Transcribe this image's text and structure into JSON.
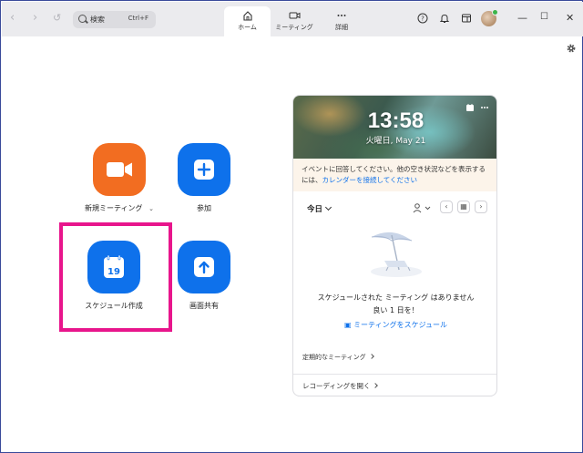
{
  "search": {
    "placeholder": "検索",
    "shortcut": "Ctrl+F"
  },
  "tabs": [
    {
      "label": "ホーム",
      "icon": "home-icon",
      "active": true
    },
    {
      "label": "ミーティング",
      "icon": "video-icon",
      "active": false
    },
    {
      "label": "詳細",
      "icon": "more-icon",
      "active": false
    }
  ],
  "window_controls": {
    "minimize": "—",
    "maximize": "☐",
    "close": "✕"
  },
  "actions": {
    "new_meeting": {
      "label": "新規ミーティング",
      "icon": "video-camera-icon",
      "color": "#f26d21"
    },
    "join": {
      "label": "参加",
      "icon": "plus-icon",
      "color": "#0e71eb"
    },
    "schedule": {
      "label": "スケジュール作成",
      "icon": "calendar-icon",
      "calendar_day": "19",
      "color": "#0e71eb"
    },
    "share_screen": {
      "label": "画面共有",
      "icon": "upload-arrow-icon",
      "color": "#0e71eb"
    }
  },
  "highlight_color": "#e8158c",
  "panel": {
    "time": "13:58",
    "date": "火曜日, May 21",
    "notice_text": "イベントに回答してください。他の空き状況などを表示するには、",
    "notice_link": "カレンダーを接続してください",
    "today_label": "今日",
    "empty_line1": "スケジュールされた ミーティング はありません",
    "empty_line2": "良い 1 日を！",
    "schedule_link": "ミーティングをスケジュール",
    "periodic_label": "定期的なミーティング",
    "recording_label": "レコーディングを開く"
  }
}
